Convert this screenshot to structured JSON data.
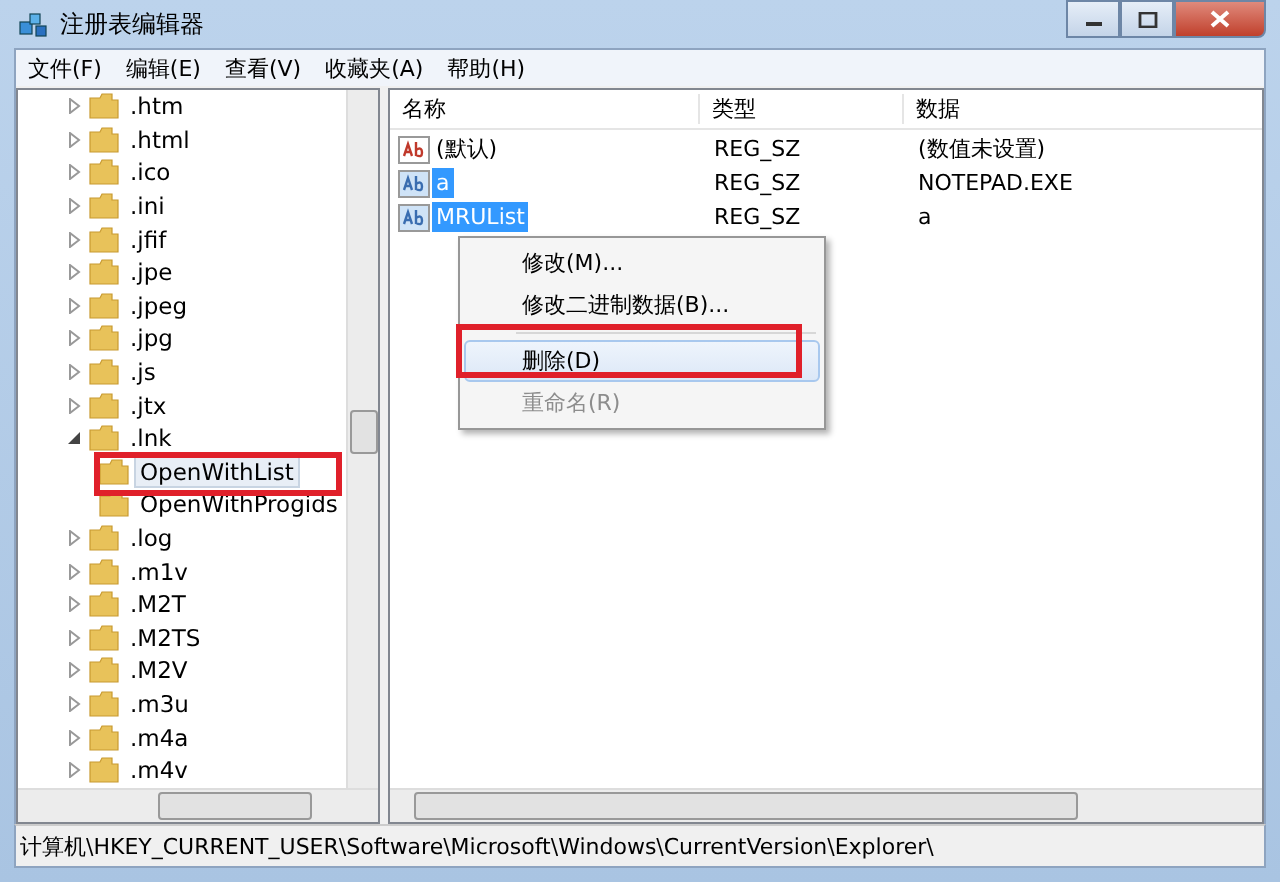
{
  "window": {
    "title": "注册表编辑器"
  },
  "menu": [
    "文件(F)",
    "编辑(E)",
    "查看(V)",
    "收藏夹(A)",
    "帮助(H)"
  ],
  "tree": [
    {
      "label": ".htm",
      "expanded": false,
      "selected": false
    },
    {
      "label": ".html",
      "expanded": false,
      "selected": false
    },
    {
      "label": ".ico",
      "expanded": false,
      "selected": false
    },
    {
      "label": ".ini",
      "expanded": false,
      "selected": false
    },
    {
      "label": ".jfif",
      "expanded": false,
      "selected": false
    },
    {
      "label": ".jpe",
      "expanded": false,
      "selected": false
    },
    {
      "label": ".jpeg",
      "expanded": false,
      "selected": false
    },
    {
      "label": ".jpg",
      "expanded": false,
      "selected": false
    },
    {
      "label": ".js",
      "expanded": false,
      "selected": false
    },
    {
      "label": ".jtx",
      "expanded": false,
      "selected": false
    },
    {
      "label": ".lnk",
      "expanded": true,
      "selected": false,
      "children": [
        {
          "label": "OpenWithList",
          "selected": true
        },
        {
          "label": "OpenWithProgids",
          "selected": false
        }
      ]
    },
    {
      "label": ".log",
      "expanded": false,
      "selected": false
    },
    {
      "label": ".m1v",
      "expanded": false,
      "selected": false
    },
    {
      "label": ".M2T",
      "expanded": false,
      "selected": false
    },
    {
      "label": ".M2TS",
      "expanded": false,
      "selected": false
    },
    {
      "label": ".M2V",
      "expanded": false,
      "selected": false
    },
    {
      "label": ".m3u",
      "expanded": false,
      "selected": false
    },
    {
      "label": ".m4a",
      "expanded": false,
      "selected": false
    },
    {
      "label": ".m4v",
      "expanded": false,
      "selected": false
    }
  ],
  "table": {
    "columns": [
      "名称",
      "类型",
      "数据"
    ],
    "rows": [
      {
        "name": "(默认)",
        "type": "REG_SZ",
        "data": "(数值未设置)",
        "selected": false
      },
      {
        "name": "a",
        "type": "REG_SZ",
        "data": "NOTEPAD.EXE",
        "selected": true
      },
      {
        "name": "MRUList",
        "type": "REG_SZ",
        "data": "a",
        "selected": true
      }
    ]
  },
  "context_menu": [
    {
      "kind": "item",
      "label": "修改(M)...",
      "disabled": false,
      "selected": false
    },
    {
      "kind": "item",
      "label": "修改二进制数据(B)...",
      "disabled": false,
      "selected": false
    },
    {
      "kind": "separator"
    },
    {
      "kind": "item",
      "label": "删除(D)",
      "disabled": false,
      "selected": true
    },
    {
      "kind": "item",
      "label": "重命名(R)",
      "disabled": true,
      "selected": false
    }
  ],
  "status_bar": "计算机\\HKEY_CURRENT_USER\\Software\\Microsoft\\Windows\\CurrentVersion\\Explorer\\"
}
